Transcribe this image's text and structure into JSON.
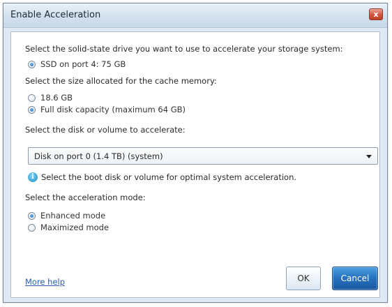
{
  "window": {
    "title": "Enable Acceleration",
    "close_label": "x"
  },
  "ssd_section": {
    "label": "Select the solid-state drive you want to use to accelerate your storage system:",
    "option": "SSD on port 4: 75 GB"
  },
  "cache_section": {
    "label": "Select the size allocated for the cache memory:",
    "options": [
      "18.6 GB",
      "Full disk capacity (maximum 64 GB)"
    ],
    "selected_index": 1
  },
  "volume_section": {
    "label": "Select the disk or volume to accelerate:",
    "selected": "Disk on port 0 (1.4 TB) (system)",
    "info_glyph": "i",
    "info": "Select the boot disk or volume for optimal system acceleration."
  },
  "mode_section": {
    "label": "Select the acceleration mode:",
    "options": [
      "Enhanced mode",
      "Maximized mode"
    ],
    "selected_index": 0
  },
  "footer": {
    "help_link": "More help",
    "ok_label": "OK",
    "cancel_label": "Cancel"
  },
  "colors": {
    "accent": "#2670bd",
    "link": "#2a5db0",
    "close": "#d2563e"
  },
  "icons": {
    "close": "close-icon",
    "info": "info-icon",
    "dropdown": "chevron-down-icon"
  }
}
